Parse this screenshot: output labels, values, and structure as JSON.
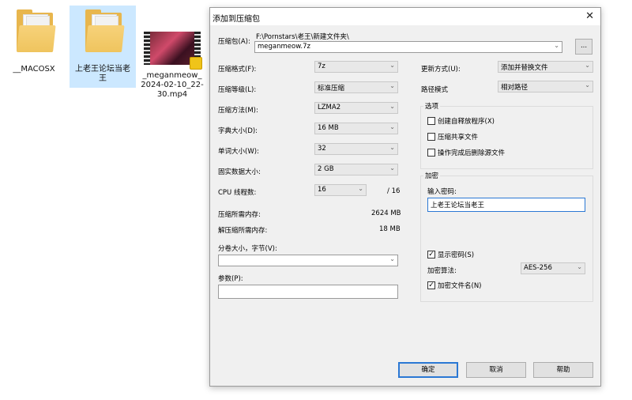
{
  "desktop": {
    "items": [
      {
        "label": "__MACOSX"
      },
      {
        "label": "上老王论坛当老王"
      },
      {
        "label": "_meganmeow_2024-02-10_22-30.mp4"
      }
    ]
  },
  "dialog": {
    "title": "添加到压缩包",
    "archive_label": "压缩包(A):",
    "archive_path": "F:\\Pornstars\\老王\\新建文件夹\\",
    "archive_name": "meganmeow.7z",
    "browse_label": "...",
    "left": {
      "format": {
        "label": "压缩格式(F):",
        "value": "7z"
      },
      "level": {
        "label": "压缩等级(L):",
        "value": "标准压缩"
      },
      "method": {
        "label": "压缩方法(M):",
        "value": "LZMA2"
      },
      "dict": {
        "label": "字典大小(D):",
        "value": "16 MB"
      },
      "word": {
        "label": "单词大小(W):",
        "value": "32"
      },
      "solid": {
        "label": "固实数据大小:",
        "value": "2 GB"
      },
      "threads": {
        "label": "CPU 线程数:",
        "value": "16",
        "max": "/ 16"
      },
      "mem_comp": {
        "label": "压缩所需内存:",
        "value": "2624 MB"
      },
      "mem_decomp": {
        "label": "解压缩所需内存:",
        "value": "18 MB"
      },
      "volume": {
        "label": "分卷大小，字节(V):",
        "value": ""
      },
      "params": {
        "label": "参数(P):",
        "value": ""
      }
    },
    "right": {
      "update": {
        "label": "更新方式(U):",
        "value": "添加并替换文件"
      },
      "path": {
        "label": "路径模式",
        "value": "相对路径"
      },
      "options": {
        "title": "选项",
        "sfx": "创建自释放程序(X)",
        "shared": "压缩共享文件",
        "delete": "操作完成后删除源文件"
      },
      "encryption": {
        "title": "加密",
        "password_label": "输入密码:",
        "password": "上老王论坛当老王",
        "show_password": "显示密码(S)",
        "method_label": "加密算法:",
        "method": "AES-256",
        "encrypt_names": "加密文件名(N)"
      }
    },
    "buttons": {
      "ok": "确定",
      "cancel": "取消",
      "help": "帮助"
    }
  }
}
